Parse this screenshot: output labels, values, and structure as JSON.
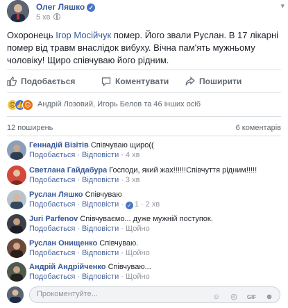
{
  "post": {
    "author": "Олег Ляшко",
    "verified_mark": "✓",
    "time": "5 хв",
    "text_before": "Охоронець ",
    "mention": "Ігор Мосійчук",
    "text_after": " помер. Його звали Руслан. В 17 лікарні помер від травм внаслідок вибуху. Вічна пам'ять мужньому чоловіку! Щиро співчуваю його рідним.",
    "options_icon": "chevron-down-icon"
  },
  "actions": {
    "like": "Подобається",
    "comment": "Коментувати",
    "share": "Поширити"
  },
  "reactions": {
    "summary": "Андрій Лозовий, Игорь Белов та 46 інших осіб",
    "icons": [
      "sad",
      "like",
      "angry"
    ]
  },
  "stats": {
    "shares": "12 поширень",
    "comments": "6 коментарів"
  },
  "comments": [
    {
      "name": "Геннадій Візітів",
      "text": "Співчуваю щиро((",
      "like": "Подобається",
      "reply": "Відповісти",
      "time": "4 хв",
      "likes": ""
    },
    {
      "name": "Светлана Гайдабура",
      "text": "Господи, який жах!!!!!!Співчуття рідним!!!!!",
      "like": "Подобається",
      "reply": "Відповісти",
      "time": "3 хв",
      "likes": ""
    },
    {
      "name": "Руслан Ляшко",
      "text": "Співчуваю",
      "like": "Подобається",
      "reply": "Відповісти",
      "time": "2 хв",
      "likes": "1"
    },
    {
      "name": "Juri Parfenov",
      "text": "Співчуваємо... дуже мужній поступок.",
      "like": "Подобається",
      "reply": "Відповісти",
      "time": "Щойно",
      "likes": ""
    },
    {
      "name": "Руслан Онищенко",
      "text": "Співчуваю.",
      "like": "Подобається",
      "reply": "Відповісти",
      "time": "Щойно",
      "likes": ""
    },
    {
      "name": "Андрій Андрійченко",
      "text": "Співчуваю...",
      "like": "Подобається",
      "reply": "Відповісти",
      "time": "Щойно",
      "likes": ""
    }
  ],
  "composer": {
    "placeholder": "Прокоментуйте...",
    "value": ""
  },
  "colors": {
    "link": "#385898",
    "meta": "#90949c",
    "like_blue": "#4a76c7"
  }
}
